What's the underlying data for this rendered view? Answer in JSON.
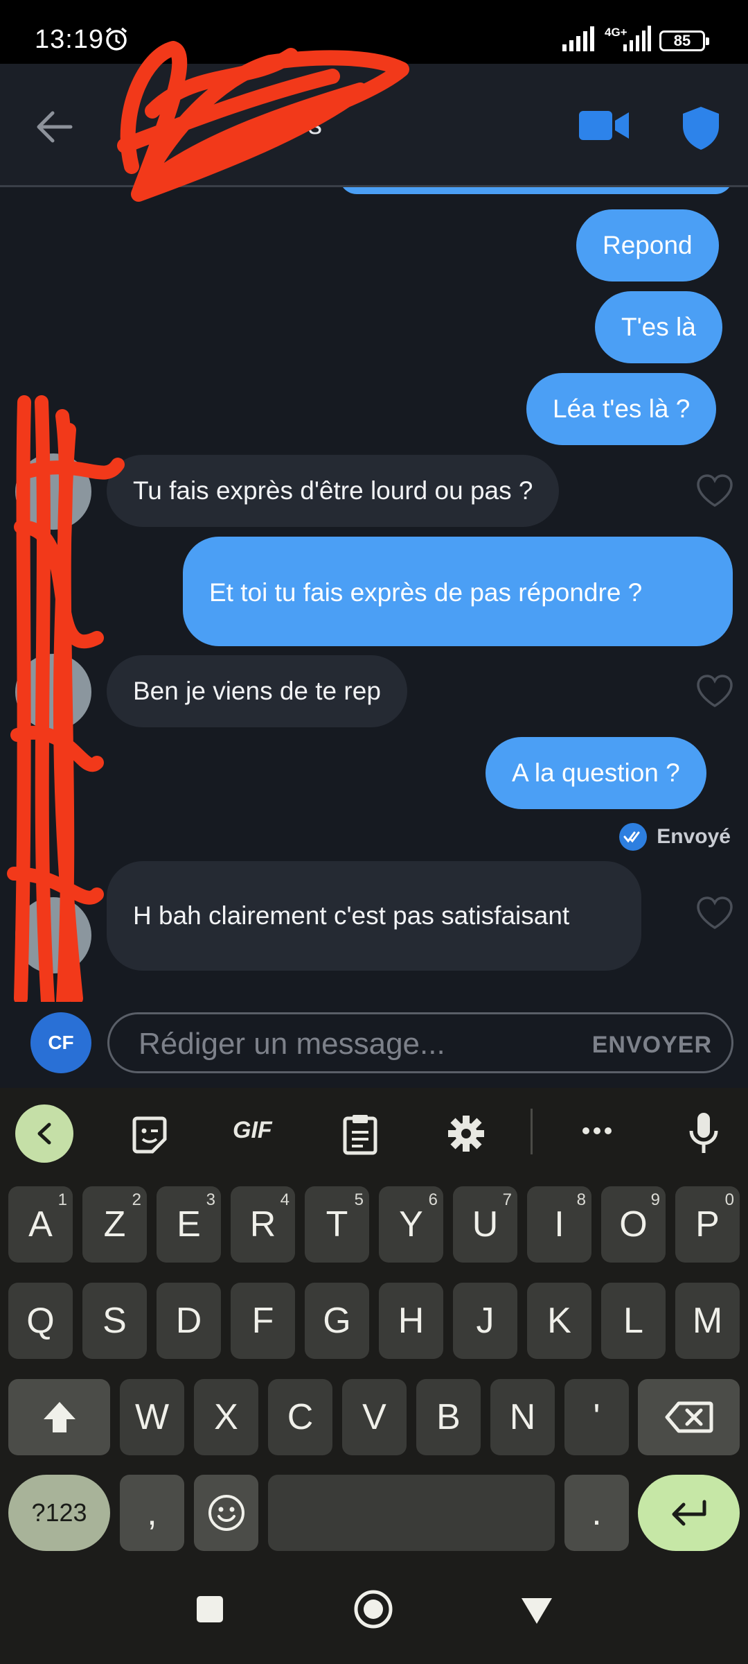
{
  "status_bar": {
    "time": "13:19",
    "network": "4G+",
    "battery": "85"
  },
  "header": {
    "contact_name": "s"
  },
  "messages": [
    {
      "dir": "out",
      "text": "Repond"
    },
    {
      "dir": "out",
      "text": "T'es là"
    },
    {
      "dir": "out",
      "text": "Léa t'es là ?"
    },
    {
      "dir": "in",
      "text": "Tu fais exprès d'être lourd ou pas ?"
    },
    {
      "dir": "out",
      "text": "Et toi tu fais exprès de pas répondre ?"
    },
    {
      "dir": "in",
      "text": "Ben je viens de te rep"
    },
    {
      "dir": "out",
      "text": "A la question ?"
    },
    {
      "dir": "in",
      "text": "H bah clairement c'est pas satisfaisant"
    }
  ],
  "delivery_status": "Envoyé",
  "compose": {
    "avatar_initials": "CF",
    "placeholder": "Rédiger un message...",
    "send_label": "ENVOYER"
  },
  "keyboard": {
    "toolbar": [
      "back",
      "sticker",
      "GIF",
      "clipboard",
      "settings",
      "more",
      "mic"
    ],
    "gif_label": "GIF",
    "row1": [
      {
        "k": "A",
        "n": "1"
      },
      {
        "k": "Z",
        "n": "2"
      },
      {
        "k": "E",
        "n": "3"
      },
      {
        "k": "R",
        "n": "4"
      },
      {
        "k": "T",
        "n": "5"
      },
      {
        "k": "Y",
        "n": "6"
      },
      {
        "k": "U",
        "n": "7"
      },
      {
        "k": "I",
        "n": "8"
      },
      {
        "k": "O",
        "n": "9"
      },
      {
        "k": "P",
        "n": "0"
      }
    ],
    "row2": [
      "Q",
      "S",
      "D",
      "F",
      "G",
      "H",
      "J",
      "K",
      "L",
      "M"
    ],
    "row3": [
      "W",
      "X",
      "C",
      "V",
      "B",
      "N",
      "'"
    ],
    "symbols_label": "?123",
    "comma": ",",
    "period": "."
  },
  "colors": {
    "outgoing": "#4b9ff5",
    "incoming": "#252a33",
    "accent": "#2d7fe0",
    "scribble": "#f2391a"
  }
}
